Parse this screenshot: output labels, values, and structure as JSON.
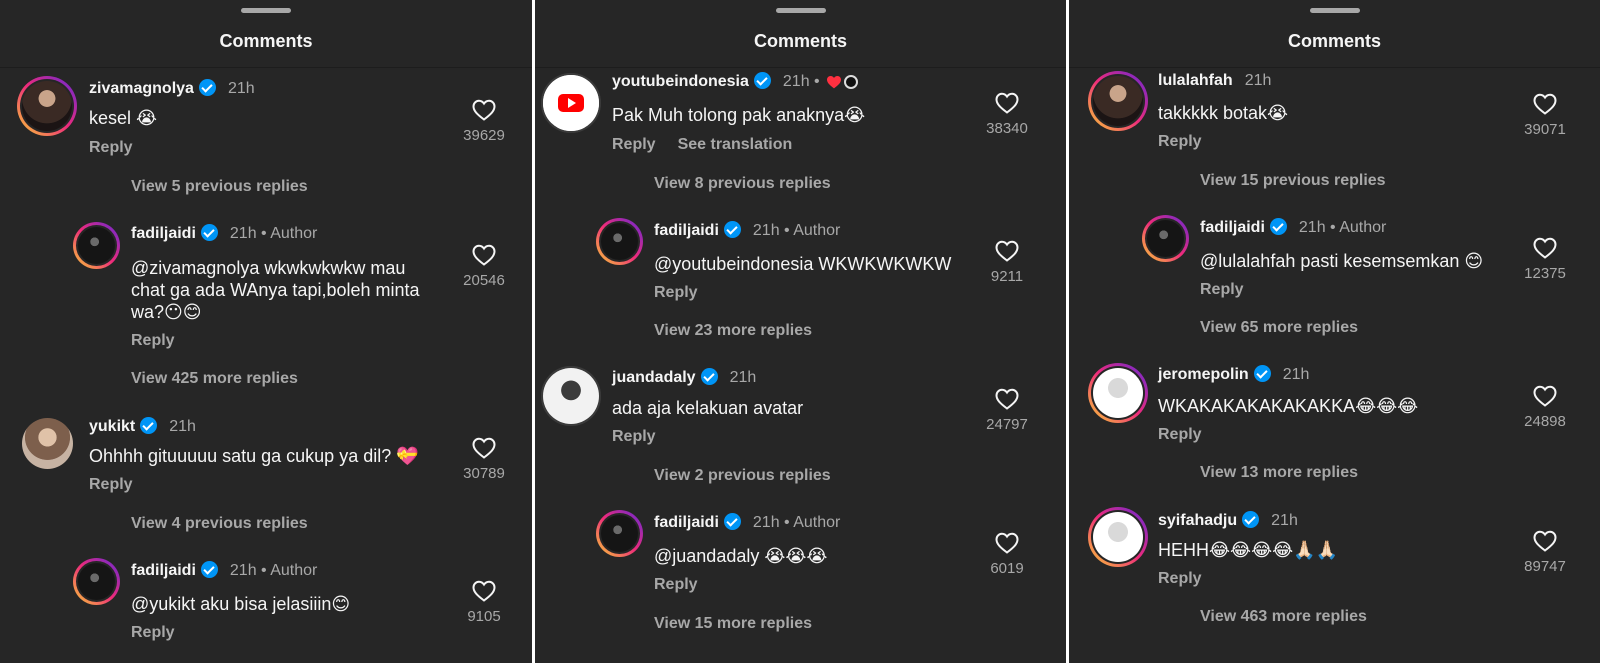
{
  "panels": [
    {
      "title": "Comments",
      "comments": [
        {
          "user": "zivamagnolya",
          "meta": "21h",
          "text": "kesel 😭",
          "reply": "Reply",
          "likes": "39629"
        },
        {
          "view": "View 5 previous replies"
        },
        {
          "user": "fadiljaidi",
          "meta": "21h • Author",
          "text": "@zivamagnolya wkwkwkwkw mau chat ga ada WAnya tapi,boleh minta wa?😶😊",
          "reply": "Reply",
          "likes": "20546"
        },
        {
          "view": "View 425 more replies"
        },
        {
          "user": "yukikt",
          "meta": "21h",
          "text": "Ohhhh gituuuuu satu ga cukup ya dil? 💝",
          "reply": "Reply",
          "likes": "30789"
        },
        {
          "view": "View 4 previous replies"
        },
        {
          "user": "fadiljaidi",
          "meta": "21h • Author",
          "text": "@yukikt aku bisa jelasiiin😊",
          "reply": "Reply",
          "likes": "9105"
        }
      ]
    },
    {
      "title": "Comments",
      "comments": [
        {
          "user": "youtubeindonesia",
          "meta": "21h •",
          "text": "Pak Muh tolong pak anaknya😭",
          "reply": "Reply",
          "translate": "See translation",
          "likes": "38340"
        },
        {
          "view": "View 8 previous replies"
        },
        {
          "user": "fadiljaidi",
          "meta": "21h • Author",
          "text": "@youtubeindonesia WKWKWKWKW",
          "reply": "Reply",
          "likes": "9211"
        },
        {
          "view": "View 23 more replies"
        },
        {
          "user": "juandadaly",
          "meta": "21h",
          "text": "ada aja kelakuan avatar",
          "reply": "Reply",
          "likes": "24797"
        },
        {
          "view": "View 2 previous replies"
        },
        {
          "user": "fadiljaidi",
          "meta": "21h • Author",
          "text": "@juandadaly 😭😭😭",
          "reply": "Reply",
          "likes": "6019"
        },
        {
          "view": "View 15 more replies"
        }
      ]
    },
    {
      "title": "Comments",
      "comments": [
        {
          "user": "lulalahfah",
          "meta": "21h",
          "text": "takkkkk botak😭",
          "reply": "Reply",
          "likes": "39071"
        },
        {
          "view": "View 15 previous replies"
        },
        {
          "user": "fadiljaidi",
          "meta": "21h • Author",
          "text": "@lulalahfah pasti kesemsemkan 😊",
          "reply": "Reply",
          "likes": "12375"
        },
        {
          "view": "View 65 more replies"
        },
        {
          "user": "jeromepolin",
          "meta": "21h",
          "text": "WKAKAKAKAKAKAKKA😂😂😂",
          "reply": "Reply",
          "likes": "24898"
        },
        {
          "view": "View 13 more replies"
        },
        {
          "user": "syifahadju",
          "meta": "21h",
          "text": "HEHH😂😂😂😂🙏🏻🙏🏻",
          "reply": "Reply",
          "likes": "89747"
        },
        {
          "view": "View 463 more replies"
        }
      ]
    }
  ],
  "icons": {
    "verified": "verified-badge-icon",
    "like": "heart-outline-icon",
    "author_reaction": "red-heart-icon"
  },
  "colors": {
    "background": "#262626",
    "text": "#f5f5f5",
    "muted": "#a8a8a8",
    "verified": "#0095f6",
    "story_ring": "#ee2a7b"
  }
}
